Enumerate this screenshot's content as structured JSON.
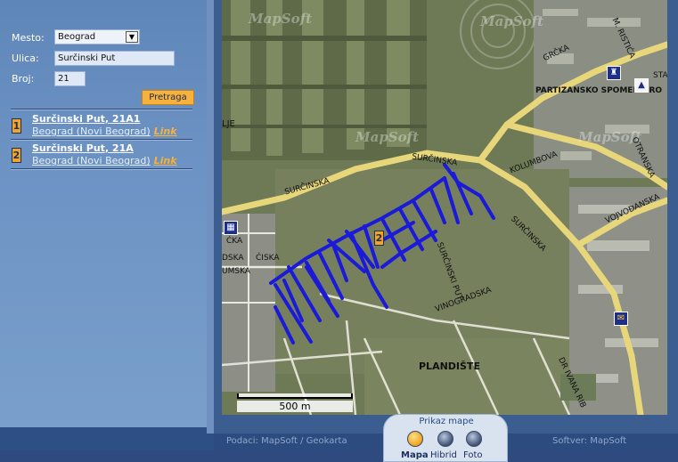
{
  "search": {
    "mesto_label": "Mesto:",
    "mesto_value": "Beograd",
    "ulica_label": "Ulica:",
    "ulica_value": "Surčinski Put",
    "broj_label": "Broj:",
    "broj_value": "21",
    "button_label": "Pretraga"
  },
  "results": [
    {
      "number": "1",
      "title": "Surčinski Put, 21A1",
      "subtitle": "Beograd (Novi Beograd)",
      "link": "Link"
    },
    {
      "number": "2",
      "title": "Surčinski Put, 21A",
      "subtitle": "Beograd (Novi Beograd)",
      "link": "Link"
    }
  ],
  "map": {
    "watermark": "MapSoft",
    "labels": {
      "surcinska_1": "SURČINSKA",
      "surcinska_2": "SURČINSKA",
      "surcinska_3": "SURČINSKA",
      "partizansko": "PARTIZANSKO SPOMEN GRO",
      "plandiste": "PLANDIŠTE",
      "grcka": "GRČKA",
      "m_ristica": "M. RISTIĆA",
      "kolumbova": "KOLUMBOVA",
      "otranska": "OTRANSKA",
      "vojvodanska": "VOJVOĐANSKA",
      "vinogradska": "VINOGRADSKA",
      "dr_ivana": "DR IVANA RIB",
      "lje": "LJE",
      "sta": "STA",
      "surcinski_put": "SURČINSKI PUT",
      "grcka_left": "ĆKA",
      "ciska": "ĆISKA",
      "dska": "DSKA",
      "umska": "UMSKA"
    },
    "marker_number": "2",
    "scale_label": "500 m"
  },
  "footer": {
    "data_credit": "Podaci: MapSoft / Geokarta",
    "software_credit": "Softver: MapSoft"
  },
  "map_type": {
    "title": "Prikaz mape",
    "options": [
      "Mapa",
      "Hibrid",
      "Foto"
    ],
    "selected": "Mapa"
  }
}
